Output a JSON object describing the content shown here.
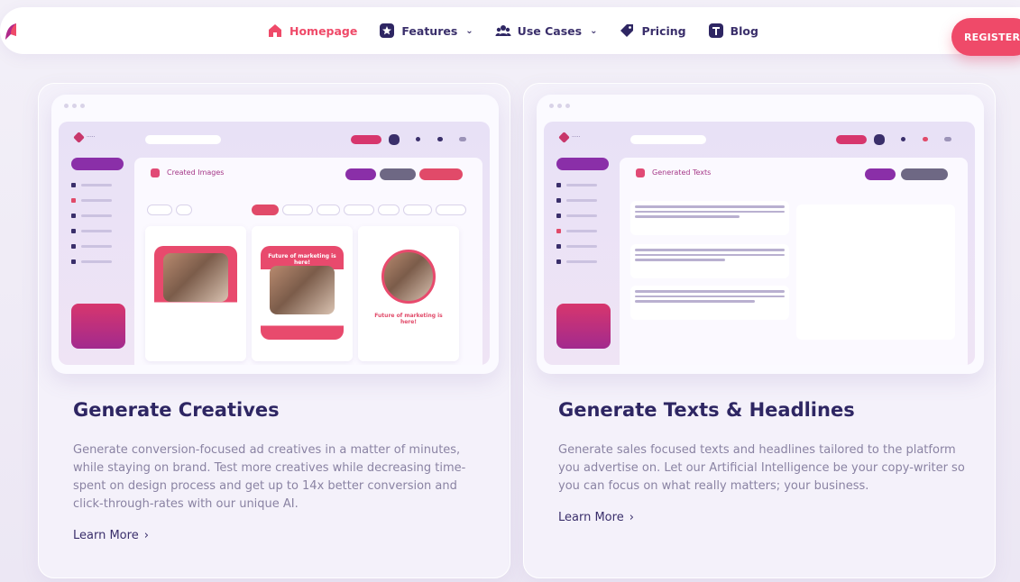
{
  "nav": {
    "items": [
      {
        "label": "Homepage",
        "icon": "home-icon",
        "active": true
      },
      {
        "label": "Features",
        "icon": "star-icon",
        "dropdown": true
      },
      {
        "label": "Use Cases",
        "icon": "users-icon",
        "dropdown": true
      },
      {
        "label": "Pricing",
        "icon": "tag-icon"
      },
      {
        "label": "Blog",
        "icon": "blog-icon"
      }
    ],
    "register_label": "REGISTER"
  },
  "cards": [
    {
      "mock_title": "Created Images",
      "thumb_captions": [
        "Future of marketing is here!",
        "Future of marketing is here!",
        "Future of marketing is here!"
      ],
      "title": "Generate Creatives",
      "description": "Generate conversion-focused ad creatives in a matter of minutes, while staying on brand. Test more creatives while decreasing time-spent on design process and get up to 14x better conversion and click-through-rates with our unique AI.",
      "learn_more": "Learn More"
    },
    {
      "mock_title": "Generated Texts",
      "title": "Generate Texts & Headlines",
      "description": "Generate sales focused texts and headlines tailored to the platform you advertise on. Let our Artificial Intelligence be your copy-writer so you can focus on what really matters; your business.",
      "learn_more": "Learn More"
    }
  ],
  "colors": {
    "accent": "#ef4a69",
    "brand_dark": "#2e2663",
    "purple": "#8a2fa8"
  }
}
